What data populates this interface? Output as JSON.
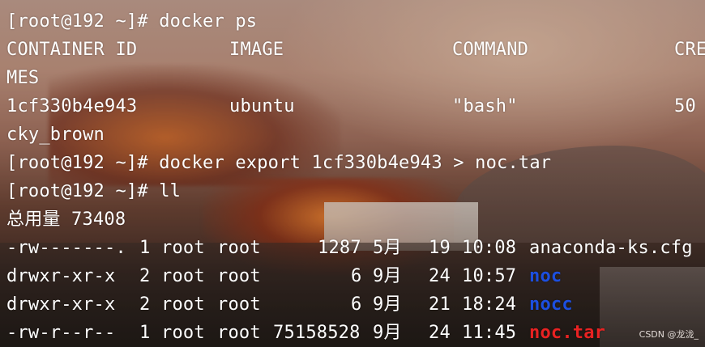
{
  "terminal": {
    "lines": {
      "l1": "[root@192 ~]# docker ps",
      "l2": {
        "c1": "CONTAINER ID",
        "c2": "IMAGE",
        "c3": "COMMAND",
        "c4": "CRE"
      },
      "l3": "MES",
      "l4": {
        "c1": "1cf330b4e943",
        "c2": "ubuntu",
        "c3": "\"bash\"",
        "c4": "50"
      },
      "l5": "cky_brown",
      "l6": "[root@192 ~]# docker export 1cf330b4e943 > noc.tar",
      "l7": "[root@192 ~]# ll",
      "l8": "总用量 73408",
      "l9": {
        "perm": "-rw-------.",
        "links": "1",
        "owner": "root",
        "group": "root",
        "size": "1287",
        "month": "5月",
        "day": "19",
        "time": "10:08",
        "name": "anaconda-ks.cfg"
      },
      "l10": {
        "perm": "drwxr-xr-x",
        "links": "2",
        "owner": "root",
        "group": "root",
        "size": "6",
        "month": "9月",
        "day": "24",
        "time": "10:57",
        "name": "noc"
      },
      "l11": {
        "perm": "drwxr-xr-x",
        "links": "2",
        "owner": "root",
        "group": "root",
        "size": "6",
        "month": "9月",
        "day": "21",
        "time": "18:24",
        "name": "nocc"
      },
      "l12": {
        "perm": "-rw-r--r--",
        "links": "1",
        "owner": "root",
        "group": "root",
        "size": "75158528",
        "month": "9月",
        "day": "24",
        "time": "11:45",
        "name": "noc.tar"
      }
    }
  },
  "watermark": "CSDN @龙泷_",
  "colors": {
    "text": "#ffffff",
    "directory": "#1c4fe0",
    "archive": "#e82222"
  }
}
